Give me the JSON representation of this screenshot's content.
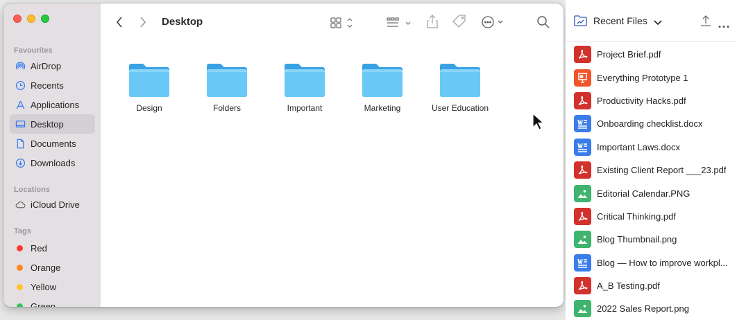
{
  "finder": {
    "window_title": "Desktop",
    "sidebar": {
      "favourites_label": "Favourites",
      "favourites": [
        {
          "label": "AirDrop",
          "icon": "airdrop-icon"
        },
        {
          "label": "Recents",
          "icon": "clock-icon"
        },
        {
          "label": "Applications",
          "icon": "applications-icon"
        },
        {
          "label": "Desktop",
          "icon": "desktop-icon",
          "active": true
        },
        {
          "label": "Documents",
          "icon": "document-icon"
        },
        {
          "label": "Downloads",
          "icon": "download-icon"
        }
      ],
      "locations_label": "Locations",
      "locations": [
        {
          "label": "iCloud Drive",
          "icon": "cloud-icon"
        }
      ],
      "tags_label": "Tags",
      "tags": [
        {
          "label": "Red",
          "color": "#fe3b30"
        },
        {
          "label": "Orange",
          "color": "#ff8a1f"
        },
        {
          "label": "Yellow",
          "color": "#ffc42e"
        },
        {
          "label": "Green",
          "color": "#30c552"
        }
      ]
    },
    "folders": [
      {
        "label": "Design"
      },
      {
        "label": "Folders"
      },
      {
        "label": "Important"
      },
      {
        "label": "Marketing"
      },
      {
        "label": "User Education"
      }
    ]
  },
  "recent_panel": {
    "title": "Recent Files",
    "files": [
      {
        "name": "Project Brief.pdf",
        "type": "pdf",
        "color": "#d2312c"
      },
      {
        "name": "Everything Prototype 1",
        "type": "slides",
        "color": "#f0542a"
      },
      {
        "name": "Productivity Hacks.pdf",
        "type": "pdf",
        "color": "#d2312c"
      },
      {
        "name": "Onboarding checklist.docx",
        "type": "word",
        "color": "#3b7de8"
      },
      {
        "name": "Important Laws.docx",
        "type": "word",
        "color": "#3b7de8"
      },
      {
        "name": "Existing Client Report ___23.pdf",
        "type": "pdf",
        "color": "#d2312c"
      },
      {
        "name": "Editorial Calendar.PNG",
        "type": "image",
        "color": "#3fb46f"
      },
      {
        "name": "Critical Thinking.pdf",
        "type": "pdf",
        "color": "#d2312c"
      },
      {
        "name": "Blog Thumbnail.png",
        "type": "image",
        "color": "#3fb46f"
      },
      {
        "name": "Blog — How to improve workpl...",
        "type": "word",
        "color": "#3b7de8"
      },
      {
        "name": "A_B Testing.pdf",
        "type": "pdf",
        "color": "#d2312c"
      },
      {
        "name": "2022 Sales Report.png",
        "type": "image",
        "color": "#3fb46f"
      }
    ]
  }
}
